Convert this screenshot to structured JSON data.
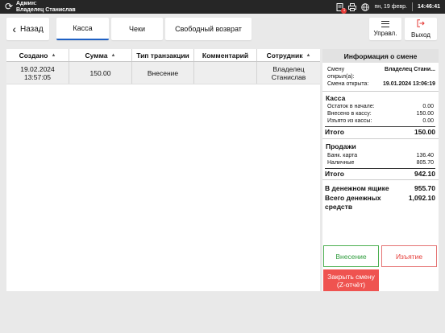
{
  "statusbar": {
    "user_role": "Админ:",
    "user_name": "Владелец Станислав",
    "notification_count": "1",
    "date": "пн, 19 февр.",
    "time": "14:46:41"
  },
  "toolbar": {
    "back": "Назад",
    "tabs": [
      "Касса",
      "Чеки",
      "Свободный возврат"
    ],
    "active_tab": "Касса",
    "manage": "Управл.",
    "exit": "Выход"
  },
  "table": {
    "columns": [
      "Создано",
      "Сумма",
      "Тип транзакции",
      "Комментарий",
      "Сотрудник"
    ],
    "rows": [
      {
        "created_date": "19.02.2024",
        "created_time": "13:57:05",
        "amount": "150.00",
        "type": "Внесение",
        "comment": "",
        "employee_first": "Владелец",
        "employee_last": "Станислав"
      }
    ]
  },
  "shift": {
    "title": "Информация о смене",
    "opened_by_label_1": "Смену",
    "opened_by_label_2": "открыл(а):",
    "opened_by_value": "Владелец Стани...",
    "opened_at_label": "Смена открыта:",
    "opened_at_value": "19.01.2024 13:06:19",
    "kassa": {
      "title": "Касса",
      "items": [
        {
          "label": "Остаток в начале:",
          "value": "0.00"
        },
        {
          "label": "Внесено в кассу:",
          "value": "150.00"
        },
        {
          "label": "Изъято из кассы:",
          "value": "0.00"
        }
      ],
      "total_label": "Итого",
      "total_value": "150.00"
    },
    "sales": {
      "title": "Продажи",
      "items": [
        {
          "label": "Банк. карта",
          "value": "136.40"
        },
        {
          "label": "Наличные",
          "value": "805.70"
        }
      ],
      "total_label": "Итого",
      "total_value": "942.10"
    },
    "drawer_label": "В денежном ящике",
    "drawer_value": "955.70",
    "total_cash_label_1": "Всего денежных",
    "total_cash_label_2": "средств",
    "total_cash_value": "1,092.10"
  },
  "actions": {
    "deposit": "Внесение",
    "withdraw": "Изъятие",
    "close_shift_1": "Закрыть смену",
    "close_shift_2": "(Z-отчёт)"
  },
  "colors": {
    "accent": "#1e60c4",
    "deposit": "#2e9c3c",
    "withdraw": "#e53935",
    "close_shift": "#ef5350"
  }
}
